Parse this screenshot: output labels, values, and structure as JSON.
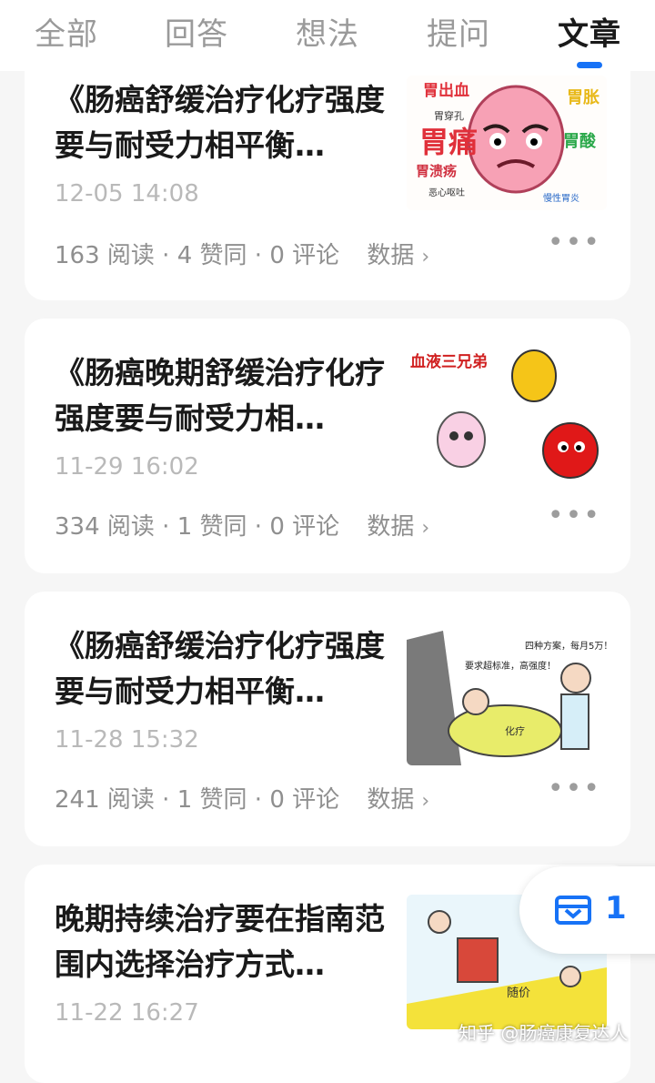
{
  "tabs": [
    "全部",
    "回答",
    "想法",
    "提问",
    "文章"
  ],
  "active_tab": "文章",
  "articles": [
    {
      "title": "《肠癌舒缓治疗化疗强度要与耐受力相平衡…",
      "date": "12-05 14:08",
      "reads": "163 阅读",
      "likes": "4 赞同",
      "comments": "0 评论",
      "data_label": "数据",
      "thumb_labels": [
        "胃出血",
        "胃穿孔",
        "胃溃疡",
        "胃痛",
        "胃胀",
        "胃酸",
        "恶心呕吐",
        "慢性胃炎"
      ]
    },
    {
      "title": "《肠癌晚期舒缓治疗化疗强度要与耐受力相…",
      "date": "11-29 16:02",
      "reads": "334 阅读",
      "likes": "1 赞同",
      "comments": "0 评论",
      "data_label": "数据",
      "thumb_labels": [
        "血液三兄弟"
      ]
    },
    {
      "title": "《肠癌舒缓治疗化疗强度要与耐受力相平衡…",
      "date": "11-28 15:32",
      "reads": "241 阅读",
      "likes": "1 赞同",
      "comments": "0 评论",
      "data_label": "数据",
      "thumb_labels": [
        "四种方案，每月5万！",
        "要求超标准，高强度！",
        "化疗"
      ]
    },
    {
      "title": "晚期持续治疗要在指南范围内选择治疗方式…",
      "date": "11-22 16:27",
      "thumb_labels": [
        "随价"
      ]
    }
  ],
  "separator": "·",
  "more": "•••",
  "fab": {
    "count": "1"
  },
  "watermark": "知乎 @肠癌康复达人",
  "colors": {
    "accent": "#1772f6",
    "background": "#f6f6f6"
  }
}
